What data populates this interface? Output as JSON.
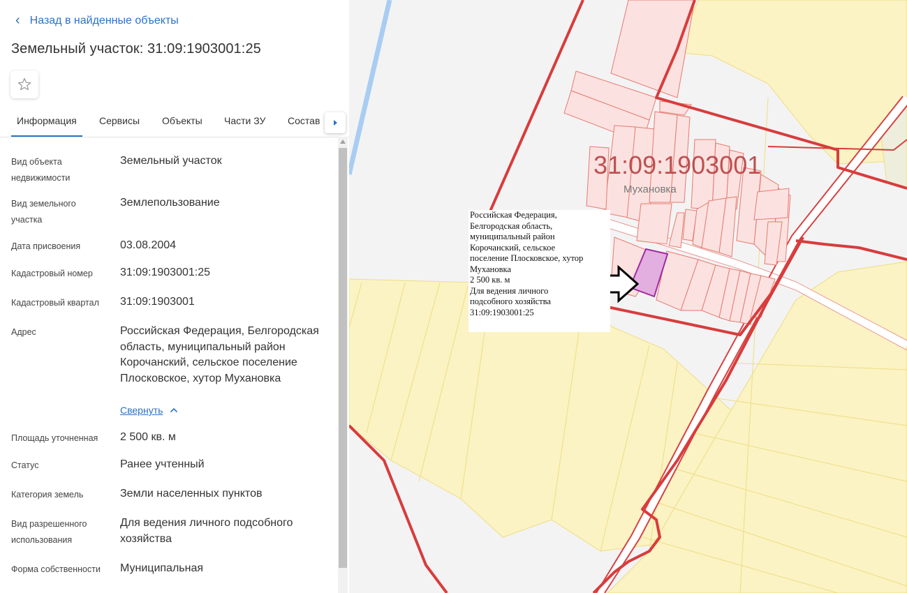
{
  "panel": {
    "back_label": "Назад в найденные объекты",
    "title": "Земельный участок: 31:09:1903001:25",
    "tabs": [
      {
        "label": "Информация",
        "active": true
      },
      {
        "label": "Сервисы"
      },
      {
        "label": "Объекты"
      },
      {
        "label": "Части ЗУ"
      },
      {
        "label": "Состав"
      }
    ],
    "fields": [
      {
        "label": "Вид объекта недвижимости",
        "value": "Земельный участок"
      },
      {
        "label": "Вид земельного участка",
        "value": "Землепользование"
      },
      {
        "label": "Дата присвоения",
        "value": "03.08.2004"
      },
      {
        "label": "Кадастровый номер",
        "value": "31:09:1903001:25"
      },
      {
        "label": "Кадастровый квартал",
        "value": "31:09:1903001"
      },
      {
        "label": "Адрес",
        "value": "Российская Федерация, Белгородская область, муниципальный район Корочанский, сельское поселение Плосковское, хутор Мухановка"
      },
      {
        "label": "Площадь уточненная",
        "value": "2 500 кв. м"
      },
      {
        "label": "Статус",
        "value": "Ранее учтенный"
      },
      {
        "label": "Категория земель",
        "value": "Земли населенных пунктов"
      },
      {
        "label": "Вид разрешенного использования",
        "value": "Для ведения личного подсобного хозяйства"
      },
      {
        "label": "Форма собственности",
        "value": "Муниципальная"
      }
    ],
    "collapse_label": "Свернуть"
  },
  "map": {
    "quarter_label": "31:09:1903001",
    "place_label": "Мухановка",
    "callout_lines": [
      "Российская Федерация,",
      "Белгородская область,",
      "муниципальный район",
      "Корочанский, сельское",
      "поселение Плосковское, хутор",
      "Мухановка",
      "2 500 кв. м",
      "Для ведения личного",
      "подсобного хозяйства",
      "31:09:1903001:25"
    ],
    "colors": {
      "yellow_fill": "#fbf3c4",
      "yellow_stroke": "#eedd80",
      "parcel_fill": "#fbe2e0",
      "parcel_stroke": "#e8796e",
      "boundary_red": "#d83c3c",
      "selected_fill": "#e3aee0",
      "selected_stroke": "#a02aa0",
      "river": "#a9cdf2"
    },
    "icons": {
      "pointer": "arrow-right-icon"
    }
  }
}
